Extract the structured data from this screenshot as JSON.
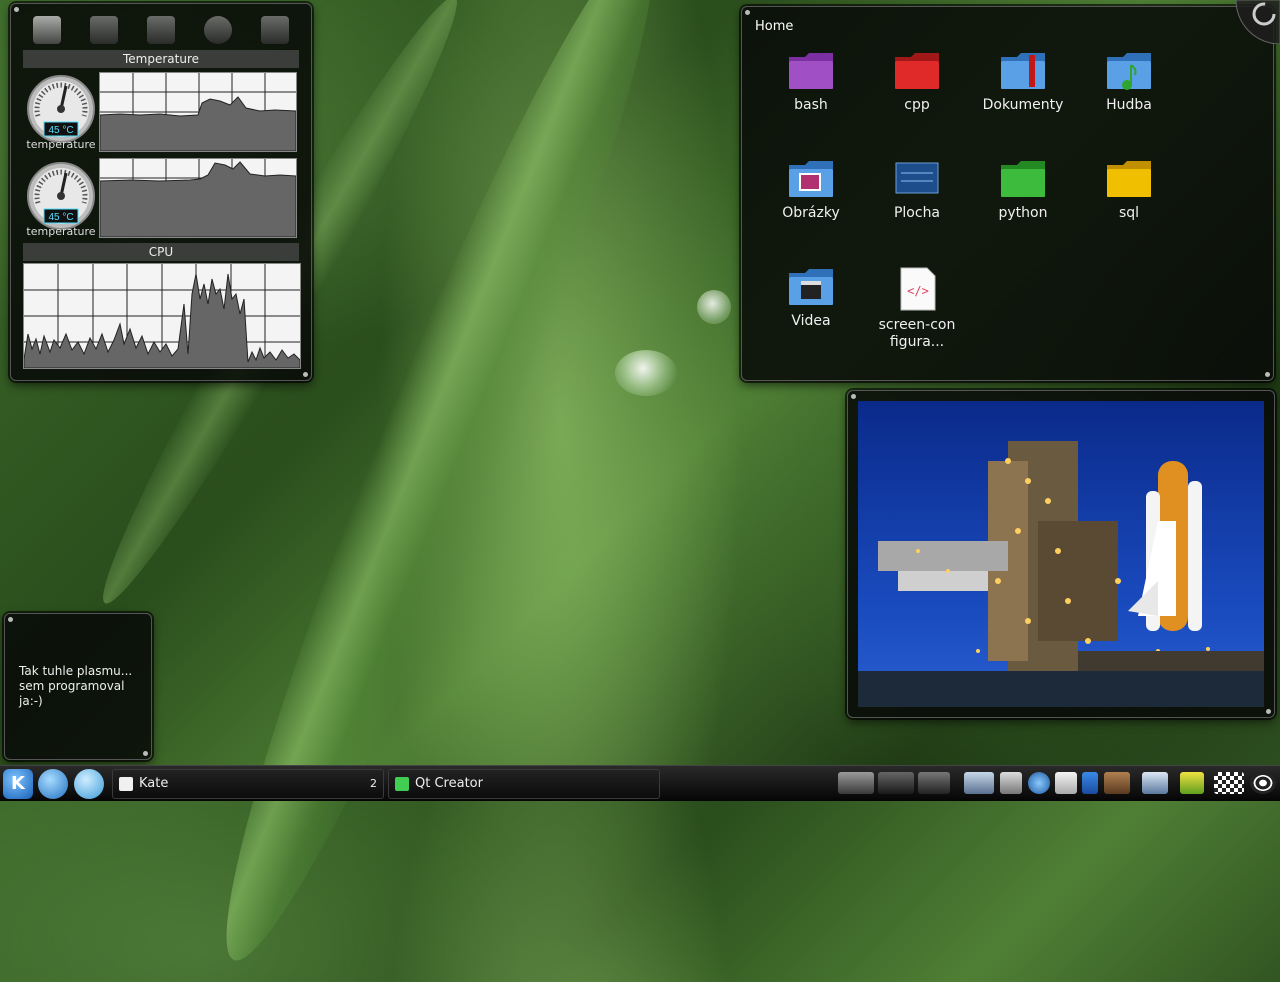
{
  "desktop": {
    "background": "green grass blade with water drops"
  },
  "system_monitor": {
    "icons": [
      "chip-icon",
      "memory-icon",
      "network-card-icon",
      "globe-icon",
      "hard-disk-icon"
    ],
    "temperature_section_title": "Temperature",
    "sensors": [
      {
        "value": "45 °C",
        "label": "temperature",
        "level": 0.45
      },
      {
        "value": "45 °C",
        "label": "temperature",
        "level": 0.45
      }
    ],
    "cpu_section_title": "CPU"
  },
  "folder_view": {
    "title": "Home",
    "items": [
      {
        "label": "bash",
        "icon": "folder-violet-icon",
        "color": "#a04fc4"
      },
      {
        "label": "cpp",
        "icon": "folder-red-icon",
        "color": "#e02a2a"
      },
      {
        "label": "Dokumenty",
        "icon": "folder-documents-icon",
        "color": "#5aa0e6"
      },
      {
        "label": "Hudba",
        "icon": "folder-music-icon",
        "color": "#5aa0e6"
      },
      {
        "label": "Obrázky",
        "icon": "folder-pictures-icon",
        "color": "#5aa0e6"
      },
      {
        "label": "Plocha",
        "icon": "folder-desktop-icon",
        "color": "#1e4d8c"
      },
      {
        "label": "python",
        "icon": "folder-green-icon",
        "color": "#3dbb3d"
      },
      {
        "label": "sql",
        "icon": "folder-yellow-icon",
        "color": "#f0c000"
      },
      {
        "label": "Videa",
        "icon": "folder-video-icon",
        "color": "#5aa0e6"
      },
      {
        "label": "screen-configura...",
        "icon": "html-file-icon",
        "color": "#ffffff"
      }
    ]
  },
  "picture_frame": {
    "subject": "space shuttle on launch pad at night"
  },
  "note": {
    "text": "Tak tuhle plasmu... sem programoval ja:-)"
  },
  "taskbar": {
    "launchers": [
      "kde-menu-icon",
      "konqueror-icon",
      "help-icon"
    ],
    "tasks": [
      {
        "label": "Kate",
        "icon": "kate-icon",
        "badge": "2"
      },
      {
        "label": "Qt Creator",
        "icon": "qt-creator-icon"
      }
    ],
    "tray": [
      "desktop-pager-icon",
      "notes-icon",
      "window-icon",
      "network-icon",
      "volume-icon",
      "network-manager-icon",
      "clipboard-icon",
      "bluetooth-icon",
      "wallet-icon",
      "computer-icon",
      "battery-icon",
      "checkerboard-icon",
      "wireless-icon"
    ]
  },
  "colors": {
    "panel_bg": "#0a0c0a",
    "graph_bg": "#f4f4f4",
    "accent_cyan": "#4fe0ff"
  }
}
